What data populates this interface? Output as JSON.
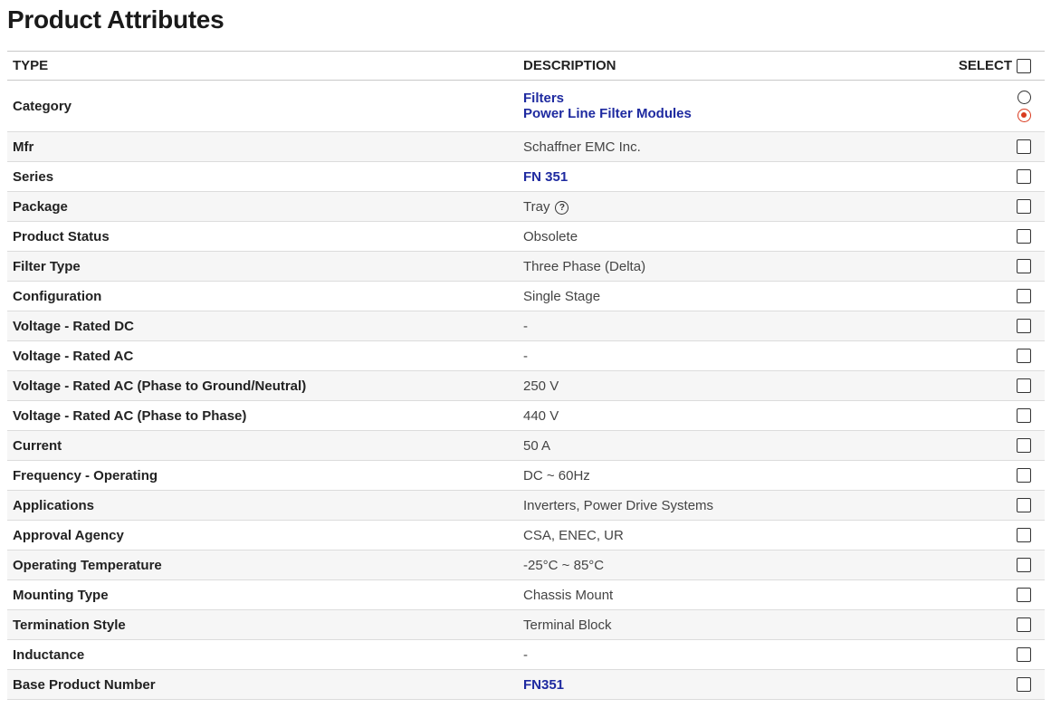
{
  "page": {
    "title": "Product Attributes"
  },
  "table": {
    "headers": {
      "type": "TYPE",
      "description": "DESCRIPTION",
      "select": "SELECT"
    },
    "category": {
      "type": "Category",
      "links": [
        "Filters",
        "Power Line Filter Modules"
      ],
      "selected_radio": 2
    },
    "rows": [
      {
        "type": "Mfr",
        "value": "Schaffner EMC Inc.",
        "link": false
      },
      {
        "type": "Series",
        "value": "FN 351",
        "link": true
      },
      {
        "type": "Package",
        "value": "Tray",
        "link": false,
        "help_icon": "question-circle-icon"
      },
      {
        "type": "Product Status",
        "value": "Obsolete",
        "link": false
      },
      {
        "type": "Filter Type",
        "value": "Three Phase (Delta)",
        "link": false
      },
      {
        "type": "Configuration",
        "value": "Single Stage",
        "link": false
      },
      {
        "type": "Voltage - Rated DC",
        "value": "-",
        "link": false
      },
      {
        "type": "Voltage - Rated AC",
        "value": "-",
        "link": false
      },
      {
        "type": "Voltage - Rated AC (Phase to Ground/Neutral)",
        "value": "250 V",
        "link": false
      },
      {
        "type": "Voltage - Rated AC (Phase to Phase)",
        "value": "440 V",
        "link": false
      },
      {
        "type": "Current",
        "value": "50 A",
        "link": false
      },
      {
        "type": "Frequency - Operating",
        "value": "DC ~ 60Hz",
        "link": false
      },
      {
        "type": "Applications",
        "value": "Inverters, Power Drive Systems",
        "link": false
      },
      {
        "type": "Approval Agency",
        "value": "CSA, ENEC, UR",
        "link": false
      },
      {
        "type": "Operating Temperature",
        "value": "-25°C ~ 85°C",
        "link": false
      },
      {
        "type": "Mounting Type",
        "value": "Chassis Mount",
        "link": false
      },
      {
        "type": "Termination Style",
        "value": "Terminal Block",
        "link": false
      },
      {
        "type": "Inductance",
        "value": "-",
        "link": false
      },
      {
        "type": "Base Product Number",
        "value": "FN351",
        "link": true
      }
    ]
  },
  "colors": {
    "link": "#1e2aa0",
    "radio_selected": "#d93a1f",
    "row_alt": "#f6f6f6"
  }
}
